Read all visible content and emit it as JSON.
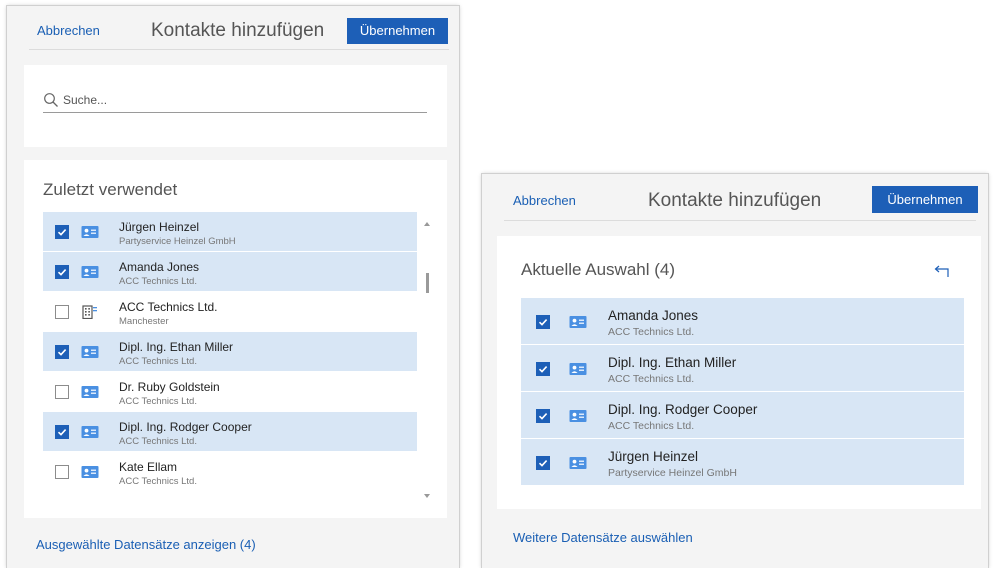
{
  "left_panel": {
    "cancel_label": "Abbrechen",
    "title": "Kontakte hinzufügen",
    "apply_label": "Übernehmen",
    "search_placeholder": "Suche...",
    "search_value": "",
    "section_title": "Zuletzt verwendet",
    "items": [
      {
        "name": "Jürgen Heinzel",
        "sub": "Partyservice Heinzel GmbH",
        "checked": true,
        "type": "contact"
      },
      {
        "name": "Amanda Jones",
        "sub": "ACC Technics Ltd.",
        "checked": true,
        "type": "contact"
      },
      {
        "name": "ACC Technics Ltd.",
        "sub": "Manchester",
        "checked": false,
        "type": "account"
      },
      {
        "name": "Dipl. Ing. Ethan Miller",
        "sub": "ACC Technics Ltd.",
        "checked": true,
        "type": "contact"
      },
      {
        "name": "Dr. Ruby Goldstein",
        "sub": "ACC Technics Ltd.",
        "checked": false,
        "type": "contact"
      },
      {
        "name": "Dipl. Ing. Rodger Cooper",
        "sub": "ACC Technics Ltd.",
        "checked": true,
        "type": "contact"
      },
      {
        "name": "Kate Ellam",
        "sub": "ACC Technics Ltd.",
        "checked": false,
        "type": "contact"
      }
    ],
    "footer_link": "Ausgewählte Datensätze anzeigen (4)"
  },
  "right_panel": {
    "cancel_label": "Abbrechen",
    "title": "Kontakte hinzufügen",
    "apply_label": "Übernehmen",
    "section_title": "Aktuelle Auswahl (4)",
    "items": [
      {
        "name": "Amanda Jones",
        "sub": "ACC Technics Ltd.",
        "checked": true,
        "type": "contact"
      },
      {
        "name": "Dipl. Ing. Ethan Miller",
        "sub": "ACC Technics Ltd.",
        "checked": true,
        "type": "contact"
      },
      {
        "name": "Dipl. Ing. Rodger Cooper",
        "sub": "ACC Technics Ltd.",
        "checked": true,
        "type": "contact"
      },
      {
        "name": "Jürgen Heinzel",
        "sub": "Partyservice Heinzel GmbH",
        "checked": true,
        "type": "contact"
      }
    ],
    "footer_link": "Weitere Datensätze auswählen"
  },
  "icons": {
    "search": "search-icon",
    "contact": "contact-card-icon",
    "account": "building-icon",
    "back": "back-arrow-icon",
    "check": "checkmark-icon"
  },
  "colors": {
    "accent": "#1d5fb7",
    "link": "#1a5fb4",
    "selected_row": "#d8e6f5",
    "contact_icon": "#4a90e2"
  }
}
